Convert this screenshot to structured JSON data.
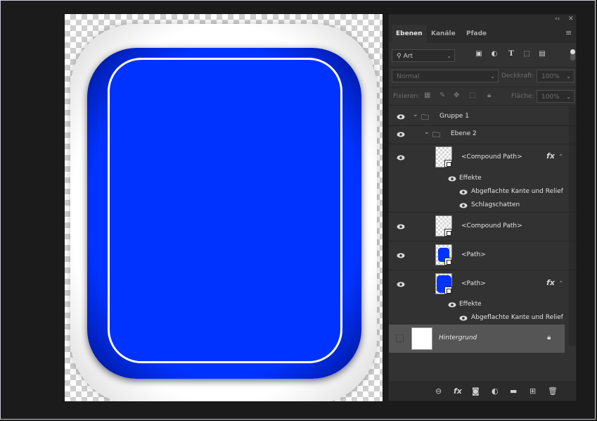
{
  "panel": {
    "tabs": [
      "Ebenen",
      "Kanäle",
      "Pfade"
    ],
    "filter": {
      "value": "Art"
    },
    "blend_mode": "Normal",
    "opacity_label": "Deckkraft:",
    "opacity_value": "100%",
    "lock_label": "Fixieren:",
    "fill_label": "Fläche:",
    "fill_value": "100%"
  },
  "layers": [
    {
      "name": "Gruppe 1",
      "type": "group"
    },
    {
      "name": "Ebene 2",
      "type": "group"
    },
    {
      "name": "<Compound Path>",
      "type": "path",
      "fx": "fx"
    },
    {
      "name": "Effekte",
      "type": "effects"
    },
    {
      "name": "Abgeflachte Kante und Relief",
      "type": "effect"
    },
    {
      "name": "Schlagschatten",
      "type": "effect"
    },
    {
      "name": "<Compound Path>",
      "type": "path"
    },
    {
      "name": "<Path>",
      "type": "path"
    },
    {
      "name": "<Path>",
      "type": "path",
      "fx": "fx"
    },
    {
      "name": "Effekte",
      "type": "effects"
    },
    {
      "name": "Abgeflachte Kante und Relief",
      "type": "effect"
    },
    {
      "name": "Hintergrund",
      "type": "background"
    }
  ],
  "icons": {
    "top_controls": [
      "collapse-icon",
      "close-icon"
    ],
    "filter": [
      "image-filter-icon",
      "adjustment-filter-icon",
      "type-filter-icon",
      "shape-filter-icon",
      "smart-object-filter-icon"
    ],
    "bottom": [
      "link-icon",
      "fx-icon",
      "mask-icon",
      "adjustment-icon",
      "folder-icon",
      "new-layer-icon",
      "trash-icon"
    ]
  },
  "colors": {
    "blue_fill": "#0033ff",
    "panel_bg": "#323232",
    "selected_row": "#555555"
  }
}
